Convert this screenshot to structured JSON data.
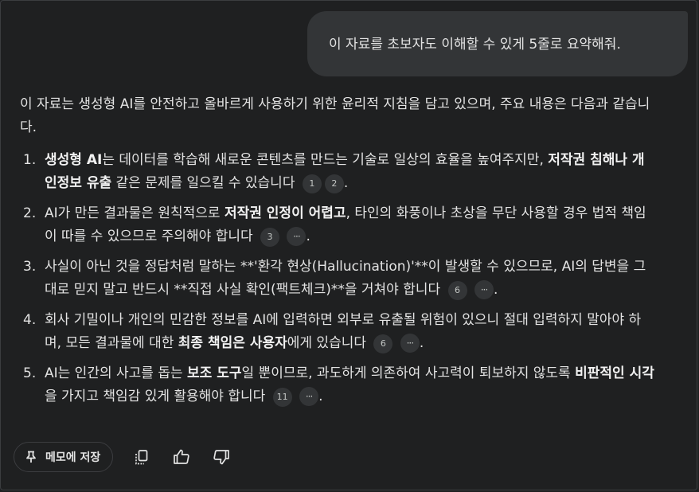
{
  "user_message": "이 자료를 초보자도 이해할 수 있게 5줄로 요약해줘.",
  "answer": {
    "intro": "이 자료는 생성형 AI를 안전하고 올바르게 사용하기 위한 윤리적 지침을 담고 있으며, 주요 내용은 다음과 같습니다.",
    "points": [
      {
        "num": "1.",
        "b1": "생성형 AI",
        "t1": "는 데이터를 학습해 새로운 콘텐츠를 만드는 기술로 일상의 효율을 높여주지만, ",
        "b2": "저작권 침해나 개인정보 유출",
        "t2": " 같은 문제를 일으킬 수 있습니다",
        "cite1": "1",
        "cite2": "2"
      },
      {
        "num": "2.",
        "t0": "AI가 만든 결과물은 원칙적으로 ",
        "b1": "저작권 인정이 어렵고",
        "t1": ", 타인의 화풍이나 초상을 무단 사용할 경우 법적 책임이 따를 수 있으므로 주의해야 합니다",
        "cite1": "3",
        "cite2": "···"
      },
      {
        "num": "3.",
        "t0": "사실이 아닌 것을 정답처럼 말하는 **'환각 현상(Hallucination)'**이 발생할 수 있으므로, AI의 답변을 그대로 믿지 말고 반드시 **직접 사실 확인(팩트체크)**을 거쳐야 합니다",
        "cite1": "6",
        "cite2": "···"
      },
      {
        "num": "4.",
        "t0": "회사 기밀이나 개인의 민감한 정보를 AI에 입력하면 외부로 유출될 위험이 있으니 절대 입력하지 말아야 하며, 모든 결과물에 대한 ",
        "b1": "최종 책임은 사용자",
        "t1": "에게 있습니다",
        "cite1": "6",
        "cite2": "···"
      },
      {
        "num": "5.",
        "t0": "AI는 인간의 사고를 돕는 ",
        "b1": "보조 도구",
        "t1": "일 뿐이므로, 과도하게 의존하여 사고력이 퇴보하지 않도록 ",
        "b2": "비판적인 시각",
        "t2": "을 가지고 책임감 있게 활용해야 합니다",
        "cite1": "11",
        "cite2": "···"
      }
    ]
  },
  "toolbar": {
    "save_memo_label": "메모에 저장",
    "icons": [
      "pin-icon",
      "copy-icon",
      "thumbs-up-icon",
      "thumbs-down-icon"
    ]
  },
  "colors": {
    "background": "#1f2021",
    "bubble": "#333537",
    "text": "#e3e3e3",
    "citation_chip": "#333537"
  }
}
